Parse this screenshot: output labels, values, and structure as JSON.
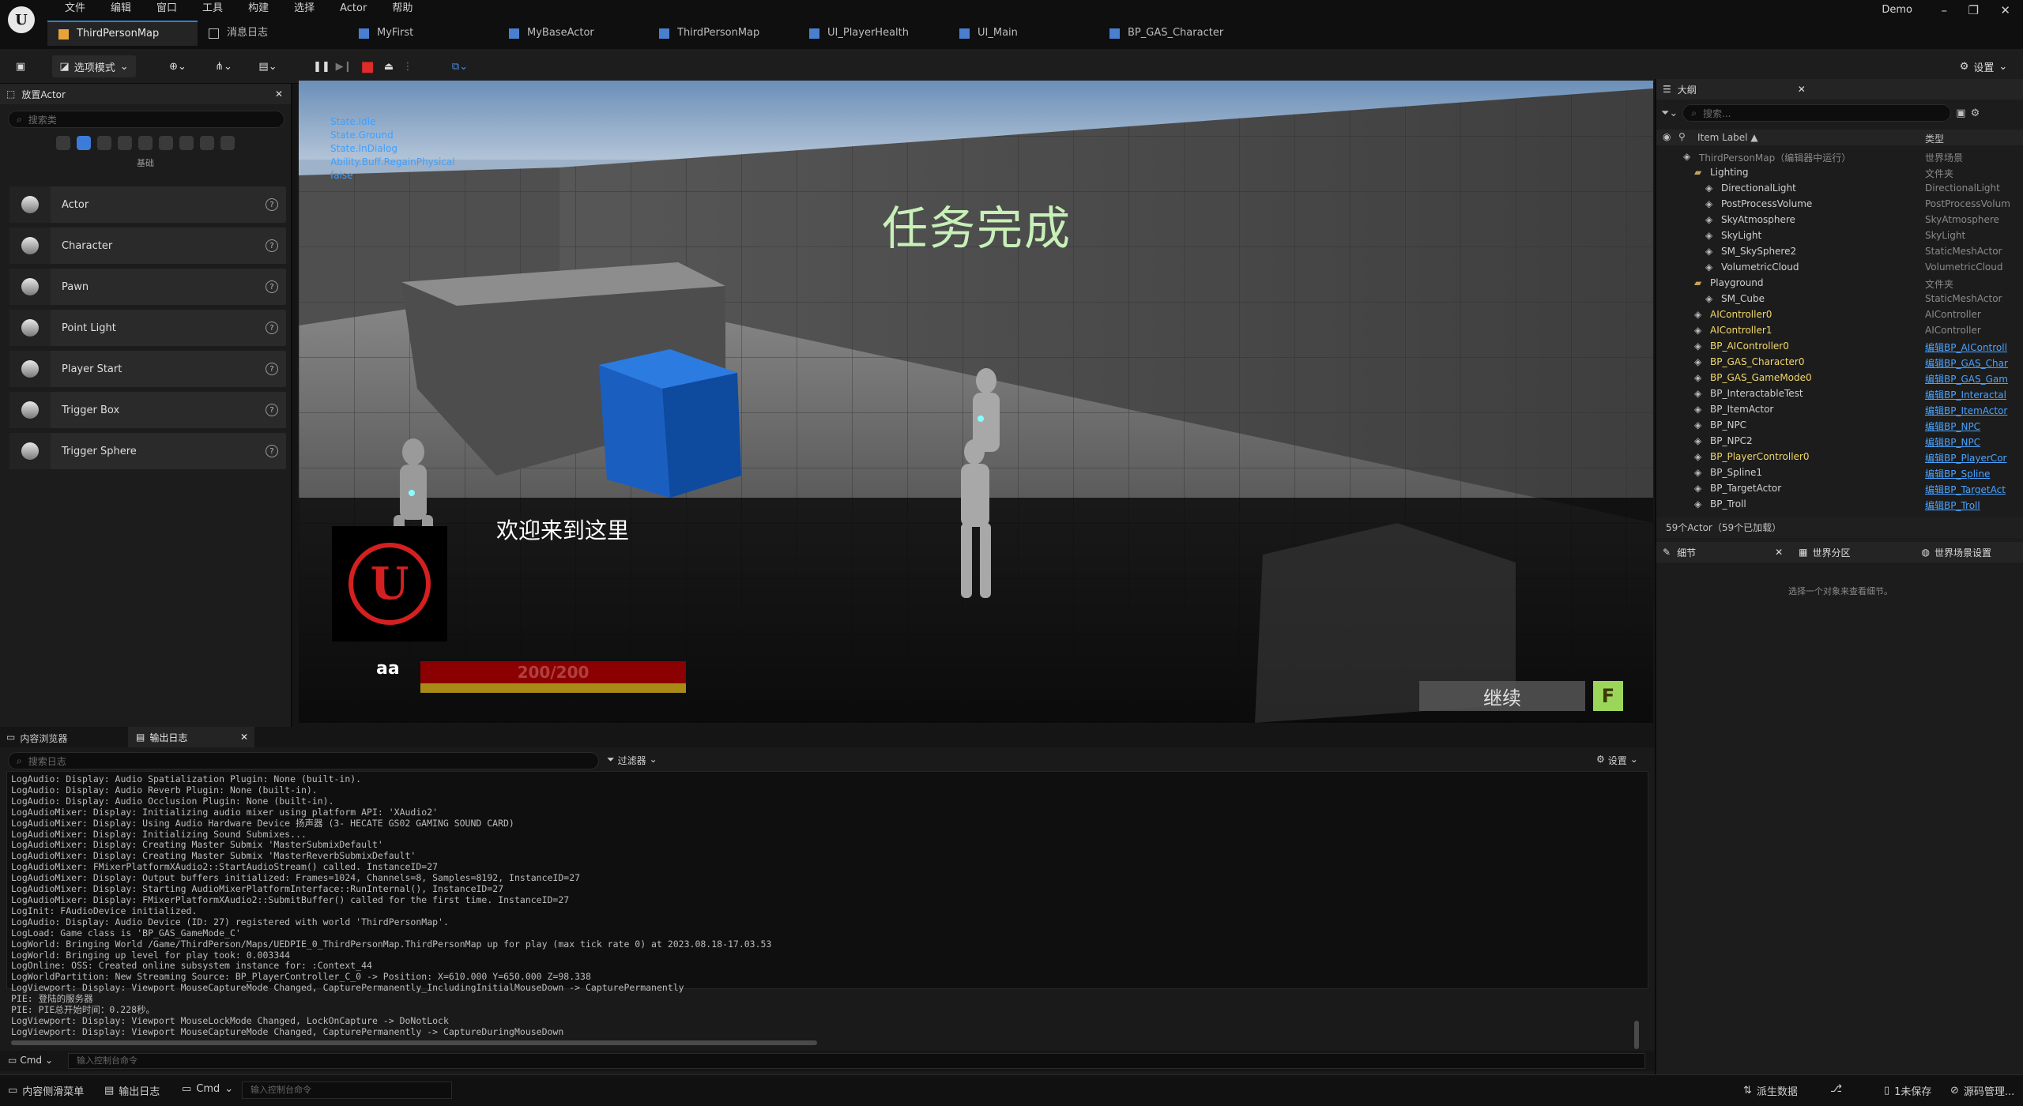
{
  "menu": [
    "文件",
    "编辑",
    "窗口",
    "工具",
    "构建",
    "选择",
    "Actor",
    "帮助"
  ],
  "tabs": [
    {
      "label": "ThirdPersonMap",
      "active": true
    },
    {
      "label": "消息日志"
    },
    {
      "label": "MyFirst"
    },
    {
      "label": "MyBaseActor"
    },
    {
      "label": "ThirdPersonMap"
    },
    {
      "label": "UI_PlayerHealth"
    },
    {
      "label": "UI_Main"
    },
    {
      "label": "BP_GAS_Character"
    }
  ],
  "user": "Demo",
  "window_controls": [
    "–",
    "❐",
    "✕"
  ],
  "toolbar": {
    "mode_label": "选项模式",
    "settings_label": "设置"
  },
  "place_actor": {
    "tab_label": "放置Actor",
    "search_placeholder": "搜索类",
    "category": "基础",
    "items": [
      "Actor",
      "Character",
      "Pawn",
      "Point Light",
      "Player Start",
      "Trigger Box",
      "Trigger Sphere"
    ]
  },
  "viewport": {
    "debug_lines": [
      "State.Idle",
      "State.Ground",
      "State.InDialog",
      "Ability.Buff.RegainPhysical",
      "false"
    ],
    "quest_text": "任务完成",
    "dialog_text": "欢迎来到这里",
    "player_name": "aa",
    "health_text": "200/200",
    "health_fraction": 1.0,
    "continue_label": "继续",
    "continue_key": "F"
  },
  "outliner": {
    "tab_label": "大纲",
    "search_placeholder": "搜索...",
    "col_label": "Item Label ▲",
    "col_type": "类型",
    "rows": [
      {
        "label": "ThirdPersonMap（编辑器中运行）",
        "type": "世界场景",
        "indent": 1,
        "dim": true
      },
      {
        "label": "Lighting",
        "type": "文件夹",
        "indent": 2
      },
      {
        "label": "DirectionalLight",
        "type": "DirectionalLight",
        "indent": 3
      },
      {
        "label": "PostProcessVolume",
        "type": "PostProcessVolum",
        "indent": 3
      },
      {
        "label": "SkyAtmosphere",
        "type": "SkyAtmosphere",
        "indent": 3
      },
      {
        "label": "SkyLight",
        "type": "SkyLight",
        "indent": 3
      },
      {
        "label": "SM_SkySphere2",
        "type": "StaticMeshActor",
        "indent": 3
      },
      {
        "label": "VolumetricCloud",
        "type": "VolumetricCloud",
        "indent": 3
      },
      {
        "label": "Playground",
        "type": "文件夹",
        "indent": 2
      },
      {
        "label": "SM_Cube",
        "type": "StaticMeshActor",
        "indent": 3
      },
      {
        "label": "AIController0",
        "type": "AIController",
        "indent": 2,
        "yellow": true
      },
      {
        "label": "AIController1",
        "type": "AIController",
        "indent": 2,
        "yellow": true
      },
      {
        "label": "BP_AIController0",
        "type": "编辑BP_AIControll",
        "indent": 2,
        "yellow": true,
        "link": true
      },
      {
        "label": "BP_GAS_Character0",
        "type": "编辑BP_GAS_Char",
        "indent": 2,
        "yellow": true,
        "link": true
      },
      {
        "label": "BP_GAS_GameMode0",
        "type": "编辑BP_GAS_Gam",
        "indent": 2,
        "yellow": true,
        "link": true
      },
      {
        "label": "BP_InteractableTest",
        "type": "编辑BP_Interactal",
        "indent": 2,
        "link": true
      },
      {
        "label": "BP_ItemActor",
        "type": "编辑BP_ItemActor",
        "indent": 2,
        "link": true
      },
      {
        "label": "BP_NPC",
        "type": "编辑BP_NPC",
        "indent": 2,
        "link": true
      },
      {
        "label": "BP_NPC2",
        "type": "编辑BP_NPC",
        "indent": 2,
        "link": true
      },
      {
        "label": "BP_PlayerController0",
        "type": "编辑BP_PlayerCor",
        "indent": 2,
        "yellow": true,
        "link": true
      },
      {
        "label": "BP_Spline1",
        "type": "编辑BP_Spline",
        "indent": 2,
        "link": true
      },
      {
        "label": "BP_TargetActor",
        "type": "编辑BP_TargetAct",
        "indent": 2,
        "link": true
      },
      {
        "label": "BP_Troll",
        "type": "编辑BP_Troll",
        "indent": 2,
        "link": true
      }
    ],
    "footer": "59个Actor（59个已加载）"
  },
  "details": {
    "tab_label": "细节",
    "tab2_label": "世界分区",
    "tab3_label": "世界场景设置",
    "empty_text": "选择一个对象来查看细节。"
  },
  "bottom": {
    "tab1": "内容浏览器",
    "tab2": "输出日志",
    "search_placeholder": "搜索日志",
    "filter_label": "过滤器",
    "settings_label": "设置",
    "cmd_label": "Cmd",
    "cmd_placeholder": "输入控制台命令"
  },
  "log_lines": [
    "LogAudio: Display: Audio Spatialization Plugin: None (built-in).",
    "LogAudio: Display: Audio Reverb Plugin: None (built-in).",
    "LogAudio: Display: Audio Occlusion Plugin: None (built-in).",
    "LogAudioMixer: Display: Initializing audio mixer using platform API: 'XAudio2'",
    "LogAudioMixer: Display: Using Audio Hardware Device 扬声器 (3- HECATE GS02 GAMING SOUND CARD)",
    "LogAudioMixer: Display: Initializing Sound Submixes...",
    "LogAudioMixer: Display: Creating Master Submix 'MasterSubmixDefault'",
    "LogAudioMixer: Display: Creating Master Submix 'MasterReverbSubmixDefault'",
    "LogAudioMixer: FMixerPlatformXAudio2::StartAudioStream() called. InstanceID=27",
    "LogAudioMixer: Display: Output buffers initialized: Frames=1024, Channels=8, Samples=8192, InstanceID=27",
    "LogAudioMixer: Display: Starting AudioMixerPlatformInterface::RunInternal(), InstanceID=27",
    "LogAudioMixer: Display: FMixerPlatformXAudio2::SubmitBuffer() called for the first time. InstanceID=27",
    "LogInit: FAudioDevice initialized.",
    "LogAudio: Display: Audio Device (ID: 27) registered with world 'ThirdPersonMap'.",
    "LogLoad: Game class is 'BP_GAS_GameMode_C'",
    "LogWorld: Bringing World /Game/ThirdPerson/Maps/UEDPIE_0_ThirdPersonMap.ThirdPersonMap up for play (max tick rate 0) at 2023.08.18-17.03.53",
    "LogWorld: Bringing up level for play took: 0.003344",
    "LogOnline: OSS: Created online subsystem instance for: :Context_44",
    "LogWorldPartition: New Streaming Source: BP_PlayerController_C_0 -> Position: X=610.000 Y=650.000 Z=98.338",
    "LogViewport: Display: Viewport MouseCaptureMode Changed, CapturePermanently_IncludingInitialMouseDown -> CapturePermanently",
    "PIE: 登陆的服务器",
    "PIE: PIE总开始时间：0.228秒。",
    "LogViewport: Display: Viewport MouseLockMode Changed, LockOnCapture -> DoNotLock",
    "LogViewport: Display: Viewport MouseCaptureMode Changed, CapturePermanently -> CaptureDuringMouseDown"
  ],
  "status": {
    "drawer": "内容侧滑菜单",
    "output": "输出日志",
    "cmd": "Cmd",
    "cmd_placeholder": "输入控制台命令",
    "derived": "派生数据",
    "unsaved": "1未保存",
    "source": "源码管理..."
  },
  "colors": {
    "accent": "#2f7fd0",
    "link": "#4aa3ff",
    "yellow": "#f1d66b",
    "quest": "#c8f0b8",
    "health_red": "#8b0000"
  }
}
